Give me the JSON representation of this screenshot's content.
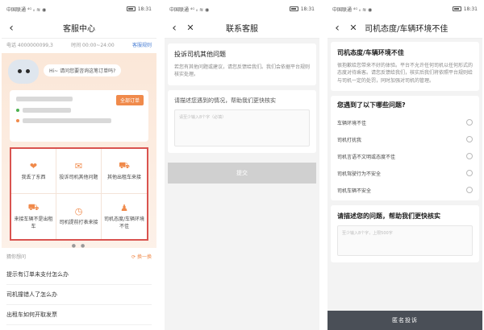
{
  "status": {
    "carrier": "中国联通 ⁴ᴳ ᵢₗ ≋ ◉",
    "time": "18:31"
  },
  "screen1": {
    "title": "客服中心",
    "phone": "电话 4000000099,3",
    "hours": "时间 00:00~24:00",
    "rules_link": "客服规则",
    "bubble": "Hi~ 请问您要咨询这笔订单吗?",
    "all_orders": "全部订单",
    "grid": [
      {
        "icon": "heart-icon",
        "glyph": "❤",
        "label": "我丢了东西"
      },
      {
        "icon": "mail-icon",
        "glyph": "✉",
        "label": "投诉司机其他问题"
      },
      {
        "icon": "car-icon",
        "glyph": "⛟",
        "label": "其他出租车来接"
      },
      {
        "icon": "car-check-icon",
        "glyph": "⛟",
        "label": "来接车辆不是出租车"
      },
      {
        "icon": "clock-icon",
        "glyph": "◷",
        "label": "司机提前打表来接"
      },
      {
        "icon": "driver-icon",
        "glyph": "♟",
        "label": "司机态度/车辆环境不佳"
      }
    ],
    "pager": "● ●",
    "guess_title": "猜你想问",
    "refresh": "⟳ 换一换",
    "questions": [
      "提示有订单未支付怎么办",
      "司机撞错人了怎么办",
      "出租车如何开取发票"
    ]
  },
  "screen2": {
    "title": "联系客服",
    "card_title": "投诉司机其他问题",
    "card_desc": "若您有其他问题或建议，请您反馈给我们。我们会依据平台规则核实处理。",
    "prompt": "请描述您遇到的情况，帮助我们更快核实",
    "placeholder": "请至少输入8个字（必填）",
    "submit": "提交"
  },
  "screen3": {
    "title": "司机态度/车辆环境不佳",
    "card_title": "司机态度/车辆环境不佳",
    "card_desc": "很抱歉给您带来不好的体验。平台不允许任何司机以任何形式的态度对待乘客。请您反馈给我们，核实后我们将依照平台规则给与司机一定的处罚，同时加强对司机的管理。",
    "question": "您遇到了以下哪些问题?",
    "options": [
      "车辆环境不佳",
      "司机打扰我",
      "司机言语不文明或态度不佳",
      "司机驾驶行为不安全",
      "司机车辆不安全"
    ],
    "describe": "请描述您的问题，帮助我们更快核实",
    "placeholder": "至少输入8个字，上限500字",
    "anon": "匿名投诉"
  }
}
